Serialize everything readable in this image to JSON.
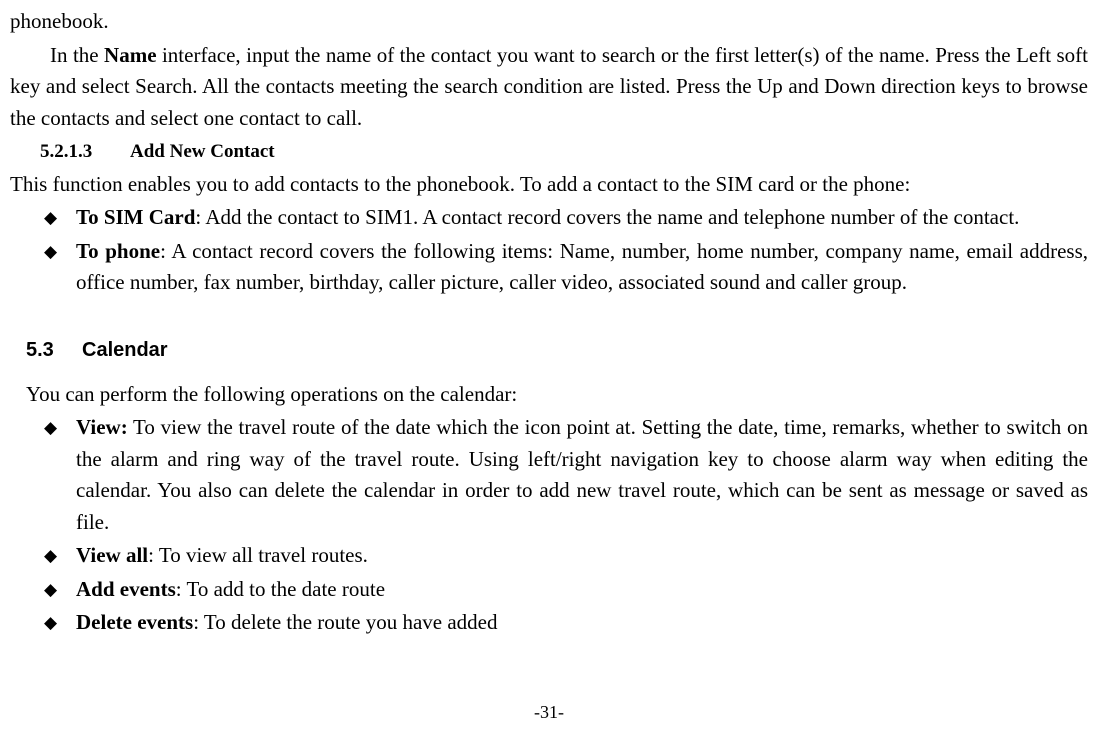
{
  "top_fragment": "phonebook.",
  "name_paragraph_pre": "In the ",
  "name_bold": "Name",
  "name_paragraph_post": " interface, input the name of the contact you want to search or the first letter(s) of the name. Press the Left soft key and select Search. All the contacts meeting the search condition are listed. Press the Up and Down direction keys to browse the contacts and select one contact to call.",
  "heading_5213_num": "5.2.1.3",
  "heading_5213_title": "Add New Contact",
  "para_5213": "This function enables you to add contacts to the phonebook. To add a contact to the SIM card or the phone:",
  "bullet1_bold": "To SIM Card",
  "bullet1_rest": ": Add the contact to SIM1. A contact record covers the name and telephone number of the contact.",
  "bullet2_bold": "To phone",
  "bullet2_rest": ": A contact record covers the following items: Name, number, home number, company name, email address, office number, fax number, birthday, caller picture, caller video, associated sound and caller group.",
  "heading_53_num": "5.3",
  "heading_53_title": "Calendar",
  "para_53": "You can perform the following operations on the calendar:",
  "cal_b1_bold": "View:",
  "cal_b1_rest": " To view the travel route of the date which the icon point at. Setting the date, time, remarks, whether to switch on the alarm and ring way of the travel route. Using left/right navigation key to choose alarm way when editing the calendar. You also can delete the calendar in order to add new travel route, which can be sent as message or saved as file.",
  "cal_b2_bold": "View all",
  "cal_b2_rest": ": To view all travel routes.",
  "cal_b3_bold": "Add events",
  "cal_b3_rest": ": To add to the date route",
  "cal_b4_bold": "Delete events",
  "cal_b4_rest": ": To delete the route you have added",
  "page_number": "-31-"
}
